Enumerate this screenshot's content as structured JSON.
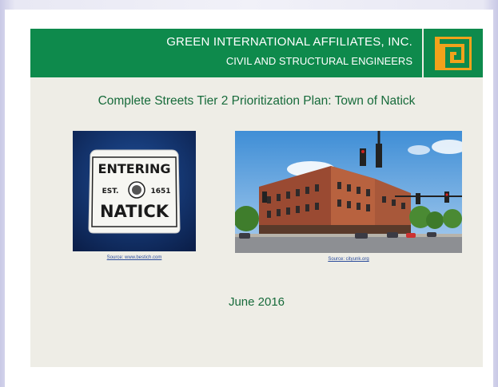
{
  "header": {
    "company": "GREEN INTERNATIONAL AFFILIATES, INC.",
    "tagline": "CIVIL AND STRUCTURAL ENGINEERS",
    "colors": {
      "banner": "#0e8a4c",
      "logo_square": "#f2a21b"
    }
  },
  "title": "Complete Streets Tier 2 Prioritization Plan: Town of Natick",
  "images": [
    {
      "sign_top": "ENTERING",
      "sign_est": "EST.",
      "sign_year": "1651",
      "sign_town": "NATICK",
      "caption": "Source: www.bestich.com"
    },
    {
      "caption": "Source: cityunk.org"
    }
  ],
  "date": "June 2016"
}
